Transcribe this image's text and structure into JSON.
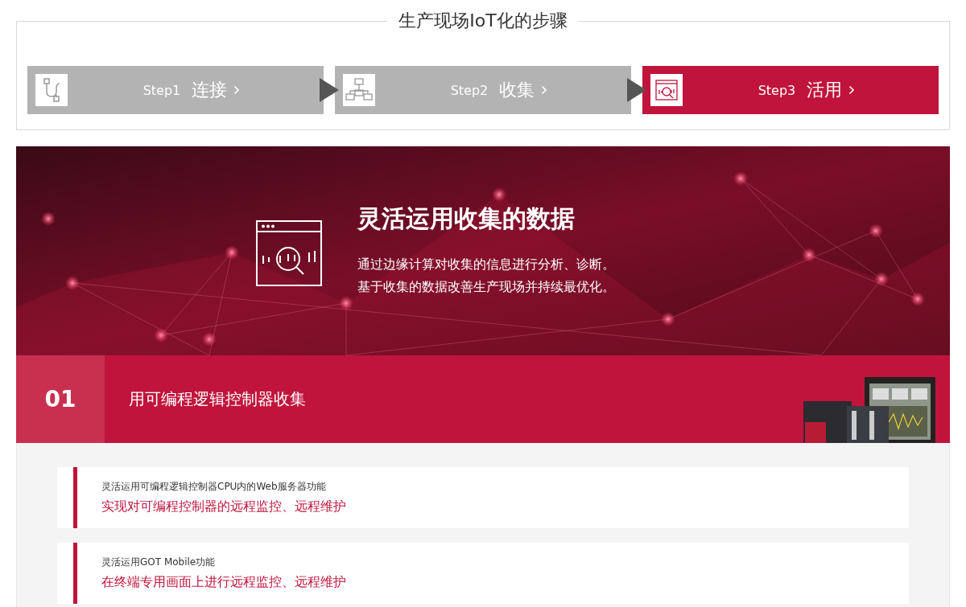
{
  "process": {
    "title": "生产现场IoT化的步骤",
    "steps": [
      {
        "step": "Step1",
        "label": "连接",
        "selected": false
      },
      {
        "step": "Step2",
        "label": "收集",
        "selected": false
      },
      {
        "step": "Step3",
        "label": "活用",
        "selected": true
      }
    ]
  },
  "hero": {
    "title": "灵活运用收集的数据",
    "lines": [
      "通过边缘计算对收集的信息进行分析、诊断。",
      "基于收集的数据改善生产现场并持续最优化。"
    ]
  },
  "section": {
    "number": "01",
    "title": "用可编程逻辑控制器收集",
    "cards": [
      {
        "caption": "灵活运用可编程逻辑控制器CPU内的Web服务器功能",
        "headline": "实现对可编程控制器的远程监控、远程维护"
      },
      {
        "caption": "灵活运用GOT Mobile功能",
        "headline": "在终端专用画面上进行远程监控、远程维护"
      }
    ]
  }
}
